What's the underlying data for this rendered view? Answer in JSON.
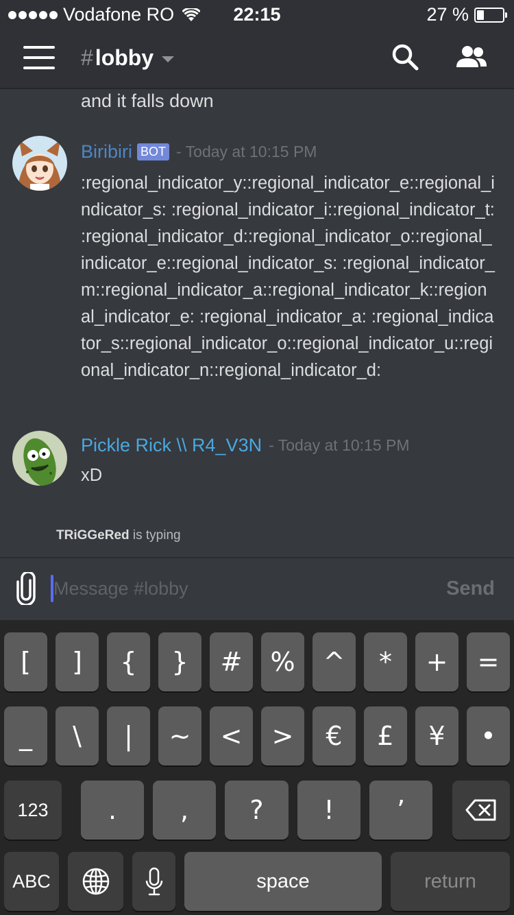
{
  "status_bar": {
    "carrier": "Vodafone RO",
    "time": "22:15",
    "battery_percent": "27 %",
    "battery_level": 0.27
  },
  "header": {
    "channel_hash": "#",
    "channel_name": "lobby"
  },
  "messages": {
    "previous_line": "and it falls down",
    "items": [
      {
        "username": "Biribiri",
        "username_color": "#4e86c4",
        "tag": "BOT",
        "timestamp": "- Today at 10:15 PM",
        "text": ":regional_indicator_y::regional_indicator_e::regional_indicator_s: :regional_indicator_i::regional_indicator_t: :regional_indicator_d::regional_indicator_o::regional_indicator_e::regional_indicator_s: :regional_indicator_m::regional_indicator_a::regional_indicator_k::regional_indicator_e: :regional_indicator_a: :regional_indicator_s::regional_indicator_o::regional_indicator_u::regional_indicator_n::regional_indicator_d:"
      },
      {
        "username": "Pickle Rick \\\\ R4_V3N",
        "username_color": "#4aa8e0",
        "timestamp": "- Today at 10:15 PM",
        "text": "xD"
      }
    ]
  },
  "typing": {
    "user": "TRiGGeRed",
    "suffix": " is typing"
  },
  "composer": {
    "placeholder": "Message #lobby",
    "send_label": "Send"
  },
  "keyboard": {
    "row1": [
      "[",
      "]",
      "{",
      "}",
      "#",
      "%",
      "^",
      "*",
      "+",
      "="
    ],
    "row2": [
      "_",
      "\\",
      "|",
      "~",
      "<",
      ">",
      "€",
      "£",
      "¥",
      "•"
    ],
    "row3": {
      "mode": "123",
      "keys": [
        ".",
        ",",
        "?",
        "!",
        "’"
      ],
      "delete_icon": "backspace-icon"
    },
    "row4": {
      "abc": "ABC",
      "globe_icon": "globe-icon",
      "mic_icon": "microphone-icon",
      "space": "space",
      "return": "return"
    }
  }
}
